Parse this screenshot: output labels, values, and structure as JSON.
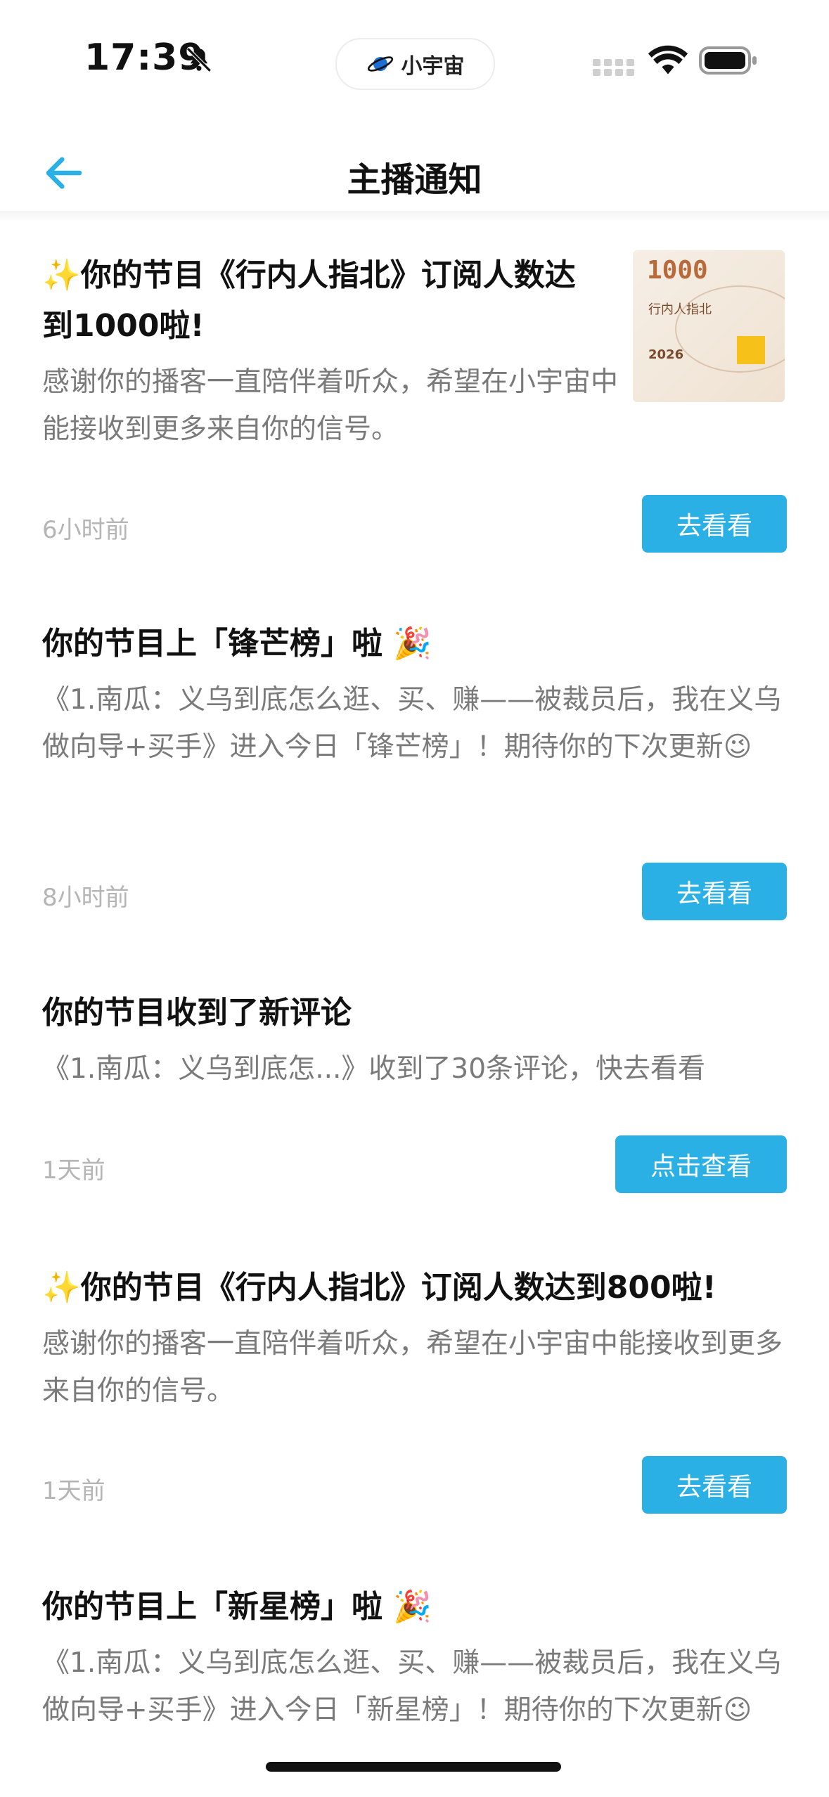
{
  "status_bar": {
    "time": "17:39",
    "app_name": "小宇宙"
  },
  "header": {
    "title": "主播通知"
  },
  "notifications": [
    {
      "title": "✨你的节目《行内人指北》订阅人数达到1000啦!",
      "body": "感谢你的播客一直陪伴着听众，希望在小宇宙中能接收到更多来自你的信号。",
      "time": "6小时前",
      "button": "去看看",
      "thumbnail": {
        "number": "1000",
        "show": "行内人指北",
        "year": "2026"
      }
    },
    {
      "title": "你的节目上「锋芒榜」啦 🎉",
      "body": "《1.南瓜：义乌到底怎么逛、买、赚——被裁员后，我在义乌做向导+买手》进入今日「锋芒榜」！期待你的下次更新😉",
      "time": "8小时前",
      "button": "去看看"
    },
    {
      "title": "你的节目收到了新评论",
      "body": "《1.南瓜：义乌到底怎...》收到了30条评论，快去看看",
      "time": "1天前",
      "button": "点击查看"
    },
    {
      "title": "✨你的节目《行内人指北》订阅人数达到800啦!",
      "body": "感谢你的播客一直陪伴着听众，希望在小宇宙中能接收到更多来自你的信号。",
      "time": "1天前",
      "button": "去看看"
    },
    {
      "title": "你的节目上「新星榜」啦 🎉",
      "body": "《1.南瓜：义乌到底怎么逛、买、赚——被裁员后，我在义乌做向导+买手》进入今日「新星榜」！期待你的下次更新😉"
    }
  ],
  "colors": {
    "accent": "#2ab0e4",
    "muted": "#7a7a7a",
    "timestamp": "#b5b5b5"
  }
}
